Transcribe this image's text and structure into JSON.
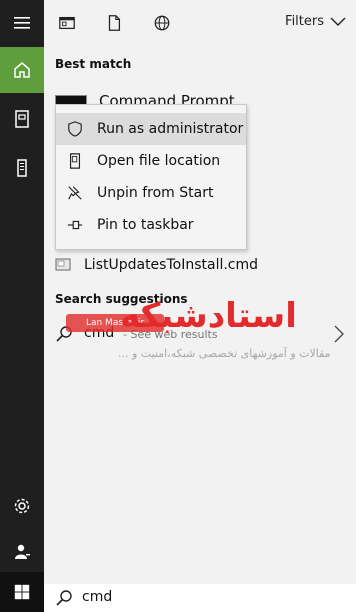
{
  "rail": {
    "items": [
      {
        "icon": "hamburger-icon"
      },
      {
        "icon": "home-icon"
      },
      {
        "icon": "documents-icon"
      },
      {
        "icon": "phone-icon"
      },
      {
        "icon": "settings-icon"
      },
      {
        "icon": "user-icon"
      },
      {
        "icon": "windows-start-icon"
      }
    ],
    "active_color": "#5f9e3c"
  },
  "topbar": {
    "filters_label": "Filters"
  },
  "best_match": {
    "title": "Best match",
    "app_name": "Command Prompt"
  },
  "context_menu": {
    "items": [
      {
        "label": "Run as administrator",
        "icon": "shield-icon"
      },
      {
        "label": "Open file location",
        "icon": "folder-icon"
      },
      {
        "label": "Unpin from Start",
        "icon": "unpin-icon"
      },
      {
        "label": "Pin to taskbar",
        "icon": "pin-icon"
      }
    ]
  },
  "other_result": {
    "name": "ListUpdatesToInstall.cmd"
  },
  "suggestions": {
    "title": "Search suggestions",
    "query": "cmd",
    "hint": "- See web results"
  },
  "watermark": {
    "title": "استادشبکه",
    "subtitle": "مقالات و آموزشهای تخصصی شبکه،امنیت و ...",
    "site": "Lan Master.ir"
  },
  "search": {
    "value": "cmd"
  }
}
